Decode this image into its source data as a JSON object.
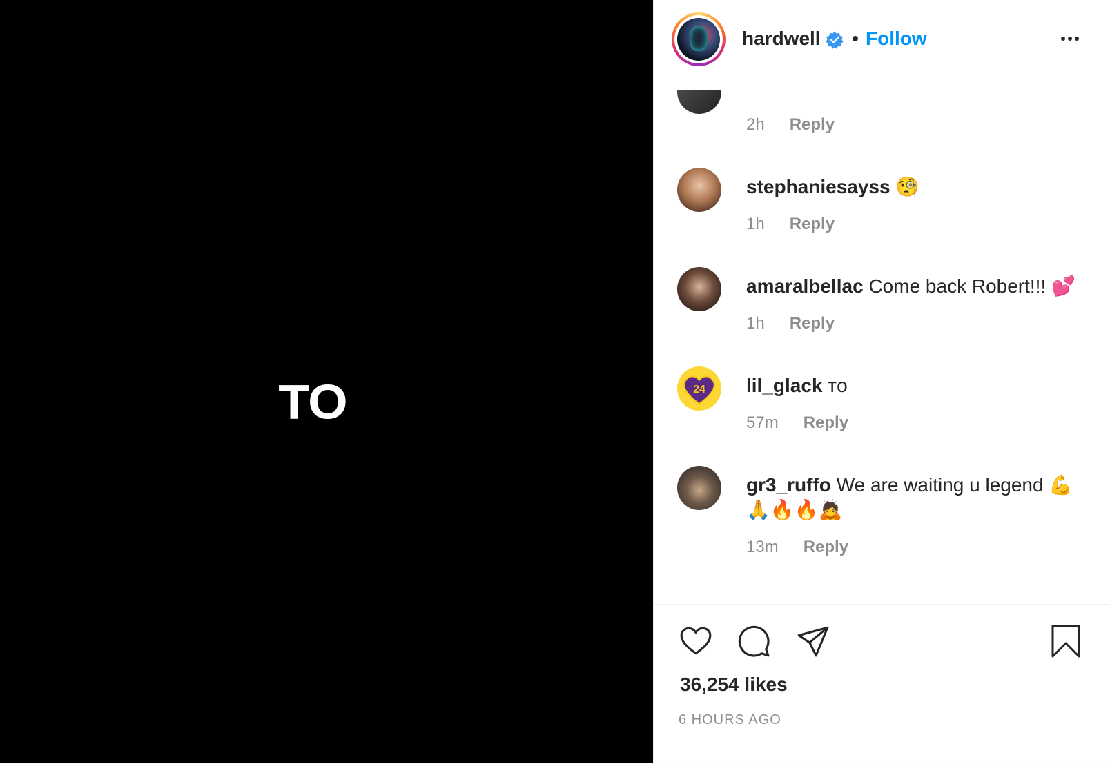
{
  "media": {
    "text": "TO"
  },
  "header": {
    "username": "hardwell",
    "separator": "•",
    "follow_label": "Follow"
  },
  "comments": [
    {
      "username": "",
      "text": "",
      "age": "2h",
      "reply_label": "Reply"
    },
    {
      "username": "stephaniesayss",
      "text": "",
      "emoji": "🧐",
      "age": "1h",
      "reply_label": "Reply"
    },
    {
      "username": "amaralbellac",
      "text": "Come back Robert!!!",
      "emoji": "💕",
      "age": "1h",
      "reply_label": "Reply"
    },
    {
      "username": "lil_glack",
      "text": "ᴛᴏ",
      "age": "57m",
      "reply_label": "Reply"
    },
    {
      "username": "gr3_ruffo",
      "text": "We are waiting u legend",
      "emoji": "💪",
      "emoji_line": "🙏🔥🔥🙇",
      "age": "13m",
      "reply_label": "Reply"
    }
  ],
  "footer": {
    "likes": "36,254 likes",
    "time": "6 HOURS AGO"
  },
  "colors": {
    "accent": "#0095f6",
    "text": "#262626",
    "muted": "#8e8e8e"
  }
}
